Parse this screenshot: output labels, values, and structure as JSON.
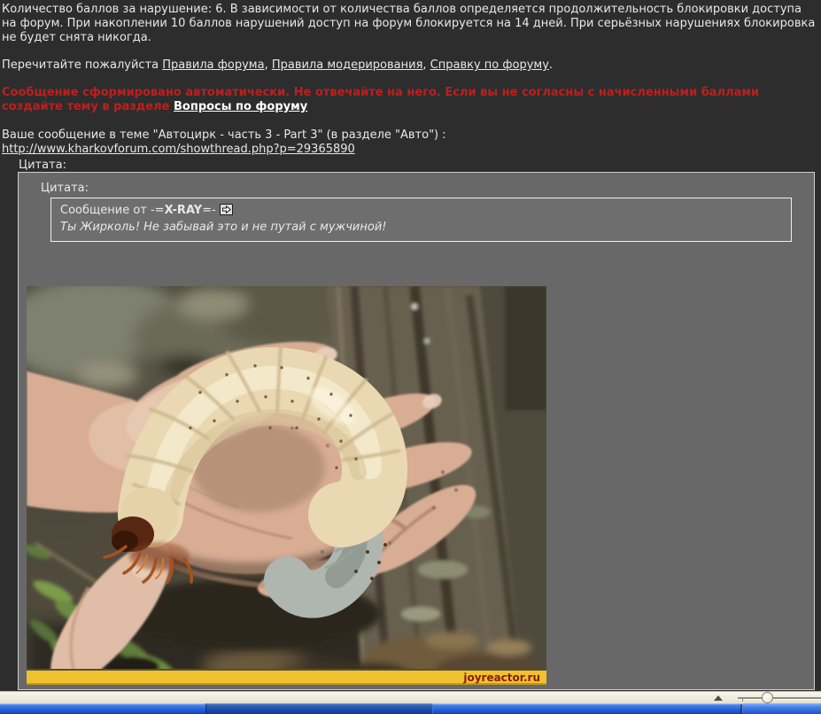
{
  "colors": {
    "page_bg": "#2d2d2d",
    "text": "#e8e8e8",
    "link": "#e8e8e8",
    "alert": "#bd1f1f",
    "quote_bg": "#686868",
    "quote_inner_bg": "#6e6e6e",
    "watermark_bar": "#f0c22f",
    "watermark_text": "#8c1a0d",
    "toolbar_bg": "#efecdd",
    "taskbar_blue": "#2a63d6"
  },
  "icons": {
    "view_post": "arrow-right",
    "toolbar_collapse": "triangle-up"
  },
  "post": {
    "intro": "Количество баллов за нарушение: 6. В зависимости от количества баллов определяется продолжительность блокировки доступа на форум. При накоплении 10 баллов нарушений доступ на форум блокируется на 14 дней. При серьёзных нарушениях блокировка не будет снята никогда.",
    "reread": {
      "prefix": "Перечитайте пожалуйста ",
      "links": [
        "Правила форума",
        "Правила модерирования",
        "Справку по форуму"
      ],
      "separator": ", ",
      "terminator": "."
    },
    "auto_notice": {
      "text": "Сообщение сформировано автоматически. Не отвечайте на него. Если вы не согласны с начисленными баллами создайте тему в разделе ",
      "link": "Вопросы по форуму"
    },
    "thread": {
      "line": "Ваше сообщение в теме \"Автоцирк - часть 3 - Part 3\" (в разделе \"Авто\") :",
      "url": "http://www.kharkovforum.com/showthread.php?p=29365890"
    }
  },
  "quote": {
    "outer_label": "Цитата:",
    "inner_label": "Цитата:",
    "origin_prefix": "Сообщение от ",
    "author_decoration_left": "-=",
    "author": "X-RAY",
    "author_decoration_right": "=-",
    "body": "Ты Жирколь! Не забывай это и не путай с мужчиной!"
  },
  "photo": {
    "watermark": "joyreactor.ru"
  }
}
